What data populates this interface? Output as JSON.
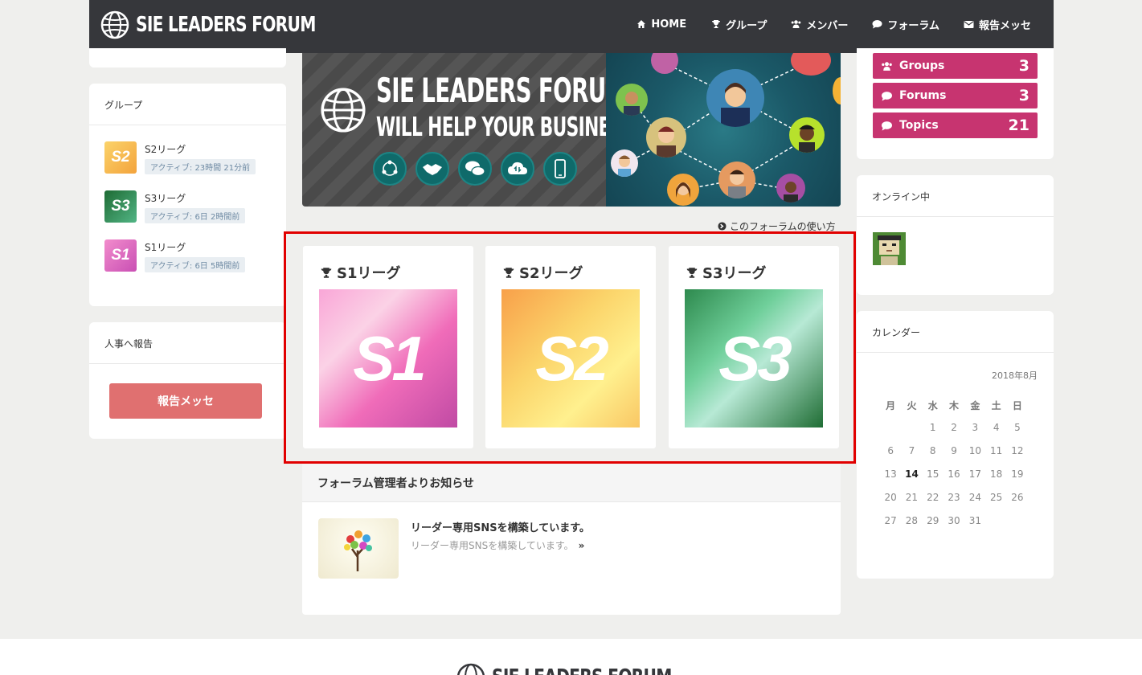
{
  "site": {
    "logo_text": "SIE LEADERS FORUM"
  },
  "nav": [
    {
      "label": "HOME",
      "icon": "home-icon"
    },
    {
      "label": "グループ",
      "icon": "trophy-icon"
    },
    {
      "label": "メンバー",
      "icon": "users-icon"
    },
    {
      "label": "フォーラム",
      "icon": "comment-icon"
    },
    {
      "label": "報告メッセ",
      "icon": "envelope-icon"
    }
  ],
  "left": {
    "groups_title": "グループ",
    "groups": [
      {
        "name": "S2リーグ",
        "badge": "S2",
        "active": "アクティブ: 23時間 21分前",
        "color": "#f4b44c"
      },
      {
        "name": "S3リーグ",
        "badge": "S3",
        "active": "アクティブ: 6日 2時間前",
        "color": "#2b8a50"
      },
      {
        "name": "S1リーグ",
        "badge": "S1",
        "active": "アクティブ: 6日 5時間前",
        "color": "#e25aa8"
      }
    ],
    "report_title": "人事へ報告",
    "report_button": "報告メッセ"
  },
  "banner": {
    "title1": "SIE LEADERS FORUM",
    "title2": "WILL HELP YOUR BUSINESS"
  },
  "howto_link": "このフォーラムの使い方",
  "leagues": [
    {
      "title": "S1リーグ",
      "badge": "S1"
    },
    {
      "title": "S2リーグ",
      "badge": "S2"
    },
    {
      "title": "S3リーグ",
      "badge": "S3"
    }
  ],
  "notice": {
    "heading": "フォーラム管理者よりお知らせ",
    "title": "リーダー専用SNSを構築しています。",
    "excerpt": "リーダー専用SNSを構築しています。",
    "more": "»"
  },
  "stats": [
    {
      "label": "Groups",
      "count": "3",
      "icon": "users-icon"
    },
    {
      "label": "Forums",
      "count": "3",
      "icon": "comment-icon"
    },
    {
      "label": "Topics",
      "count": "21",
      "icon": "comment-icon"
    }
  ],
  "online": {
    "title": "オンライン中"
  },
  "calendar": {
    "title": "カレンダー",
    "month": "2018年8月",
    "weekdays": [
      "月",
      "火",
      "水",
      "木",
      "金",
      "土",
      "日"
    ],
    "days": [
      "",
      "",
      "1",
      "2",
      "3",
      "4",
      "5",
      "6",
      "7",
      "8",
      "9",
      "10",
      "11",
      "12",
      "13",
      "14",
      "15",
      "16",
      "17",
      "18",
      "19",
      "20",
      "21",
      "22",
      "23",
      "24",
      "25",
      "26",
      "27",
      "28",
      "29",
      "30",
      "31"
    ],
    "today": "14"
  },
  "colors": {
    "accent": "#c73470",
    "header": "#36373b",
    "report": "#e07070",
    "highlight": "#e10000"
  }
}
